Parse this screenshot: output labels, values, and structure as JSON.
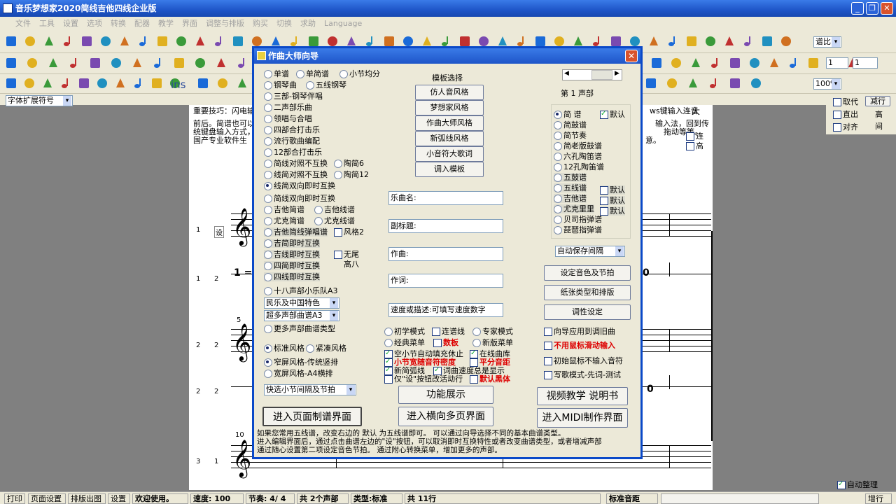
{
  "window": {
    "title": "音乐梦想家2020简线吉他四线企业版",
    "min": "_",
    "max": "❐",
    "close": "✕"
  },
  "menu": [
    "文件",
    "工具",
    "设置",
    "选项",
    "转换",
    "配器",
    "教学",
    "界面",
    "调整与排版",
    "购买",
    "切换",
    "求助",
    "Language"
  ],
  "toolbar": {
    "zoom_label": "谱比",
    "num1": "1",
    "num2": "1",
    "percent": "100%",
    "font_symbol": "字体扩展符号",
    "ins": "ins"
  },
  "right_panel": {
    "qudai": "取代",
    "jianhang": "减行",
    "zhichu": "直出",
    "gao": "高",
    "duiqi": "对齐",
    "jian": "间",
    "lian": "连",
    "gao2": "高"
  },
  "score": {
    "tip": "重要技巧：闪电输",
    "tip2": "ws键输入连音",
    "line2": "前后。简谱也可以",
    "line2b": "输入法，回到传",
    "line3": "统键盘输入方式，",
    "line3b": "拖动等等。",
    "line4": "国产专业软件生",
    "line4b": "意。",
    "da": "大",
    "row_nums": [
      "1",
      "1",
      "2",
      "2",
      "3"
    ],
    "row_sub": [
      "设",
      "2",
      "2",
      "2",
      "1"
    ],
    "measure5": "5",
    "measure10": "10",
    "one": "1 =",
    "zero1": "0",
    "zero2": "0"
  },
  "dialog": {
    "title": "作曲大师向导",
    "close": "✕",
    "template_label": "模板选择",
    "voice_label": "第 1 声部",
    "left_options": [
      {
        "label": "单谱",
        "on": false
      },
      {
        "label": "单简谱",
        "on": false
      },
      {
        "label": "小节均分",
        "on": false
      },
      {
        "label": "钢琴曲",
        "on": false
      },
      {
        "label": "五线钢琴",
        "on": false
      },
      {
        "label": "三部-钢琴伴唱",
        "on": false
      },
      {
        "label": "二声部乐曲",
        "on": false
      },
      {
        "label": "领唱与合唱",
        "on": false
      },
      {
        "label": "四部合打击乐",
        "on": false
      },
      {
        "label": "流行歌曲编配",
        "on": false
      },
      {
        "label": "12部合打击乐",
        "on": false
      },
      {
        "label": "简线对照不互换",
        "on": false
      },
      {
        "label": "陶简6",
        "on": false
      },
      {
        "label": "线简对照不互换",
        "on": false
      },
      {
        "label": "陶简12",
        "on": false
      },
      {
        "label": "线简双向即时互换",
        "on": true
      },
      {
        "label": "简线双向即时互换",
        "on": false
      },
      {
        "label": "吉他简谱",
        "on": false
      },
      {
        "label": "吉他线谱",
        "on": false
      },
      {
        "label": "尤克简谱",
        "on": false
      },
      {
        "label": "尤克线谱",
        "on": false
      },
      {
        "label": "吉他简线弹唱谱",
        "on": false
      },
      {
        "label": "吉简即时互换",
        "on": false
      },
      {
        "label": "吉线即时互换",
        "on": false
      },
      {
        "label": "四简即时互换",
        "on": false
      },
      {
        "label": "四线即时互换",
        "on": false
      },
      {
        "label": "十八声部小乐队A3",
        "on": false
      },
      {
        "label": "更多声部曲谱类型",
        "on": false
      }
    ],
    "fengge2": "风格2",
    "wuwei": "无尾",
    "gaoba": "高八",
    "select1": "民乐及中国特色",
    "select2": "超多声部曲谱A3",
    "style_std": "标准风格",
    "style_tight": "紧凑风格",
    "layout1": "窄屏风格-传统竖排",
    "layout2": "宽屏风格-A4横排",
    "quick_select": "快选小节间隔及节拍",
    "template_buttons": [
      "仿人音风格",
      "梦想家风格",
      "作曲大师风格",
      "新弧线风格",
      "小音符大歌词",
      "调入模板"
    ],
    "fields": {
      "title": "乐曲名:",
      "subtitle": "副标题:",
      "composer": "作曲:",
      "lyricist": "作词:",
      "tempo": "速度或描述:可填写速度数字"
    },
    "modes": {
      "beginner": "初学模式",
      "legato": "连谱线",
      "expert": "专家模式",
      "classic": "经典菜单",
      "shuban": "数板",
      "newmenu": "新版菜单"
    },
    "checks": [
      {
        "label": "空小节自动填充休止",
        "on": true
      },
      {
        "label": "在线曲库",
        "on": true
      },
      {
        "label": "小节宽随音符密度",
        "on": true
      },
      {
        "label": "平分音距",
        "on": false
      },
      {
        "label": "新简弧线",
        "on": true
      },
      {
        "label": "词曲速度总是显示",
        "on": true
      },
      {
        "label": "仅\"设\"按钮改活动行",
        "on": false
      },
      {
        "label": "默认黑体",
        "on": false
      }
    ],
    "right_types": [
      {
        "label": "简  谱",
        "on": true
      },
      {
        "label": "简鼓谱",
        "on": false
      },
      {
        "label": "简节奏",
        "on": false
      },
      {
        "label": "简老版鼓谱",
        "on": false
      },
      {
        "label": "六孔陶笛谱",
        "on": false
      },
      {
        "label": "12孔陶笛谱",
        "on": false
      },
      {
        "label": "五鼓谱",
        "on": false
      },
      {
        "label": "五线谱",
        "on": false
      },
      {
        "label": "吉他谱",
        "on": false
      },
      {
        "label": "尤克里里",
        "on": false
      },
      {
        "label": "贝司指弹谱",
        "on": false
      },
      {
        "label": "琵琶指弹谱",
        "on": false
      }
    ],
    "default_label": "默认",
    "autosave": "自动保存间隔",
    "right_buttons": [
      "设定音色及节拍",
      "纸张类型和排版",
      "调性设定"
    ],
    "right_checks": [
      {
        "label": "向导应用到调旧曲",
        "red": false
      },
      {
        "label": "不用鼠标滑动输入",
        "red": true
      },
      {
        "label": "初始鼠标不输入音符",
        "red": false
      },
      {
        "label": "写歌模式-先词-测试",
        "red": false
      }
    ],
    "big_buttons": {
      "func": "功能展示",
      "video": "视频教学 说明书",
      "page": "进入页面制谱界面",
      "multi": "进入横向多页界面",
      "midi": "进入MIDI制作界面"
    },
    "help1": "如果您常用五线谱，改变右边的 默认 为五线谱即可。        可以通过向导选择不同的基本曲谱类型。",
    "help2": "进入编辑界面后，通过点击曲谱左边的\"设\"按钮，可以取消即时互换特性或者改变曲谱类型，或者增减声部",
    "help3": "通过随心设置第二项设定音色节拍。          通过附心转换菜单，增加更多的声部。"
  },
  "status": {
    "print": "打印",
    "page_setup": "页面设置",
    "print_layout": "排版出图",
    "settings": "设置",
    "welcome": "欢迎使用。",
    "speed": "速度: 100",
    "beat": "节奏: 4/ 4",
    "voices": "共 2个声部",
    "type": "类型:标准",
    "lines": "共 11行",
    "std_sound": "标准音距",
    "auto_arrange": "自动整理",
    "add_line": "增行"
  }
}
